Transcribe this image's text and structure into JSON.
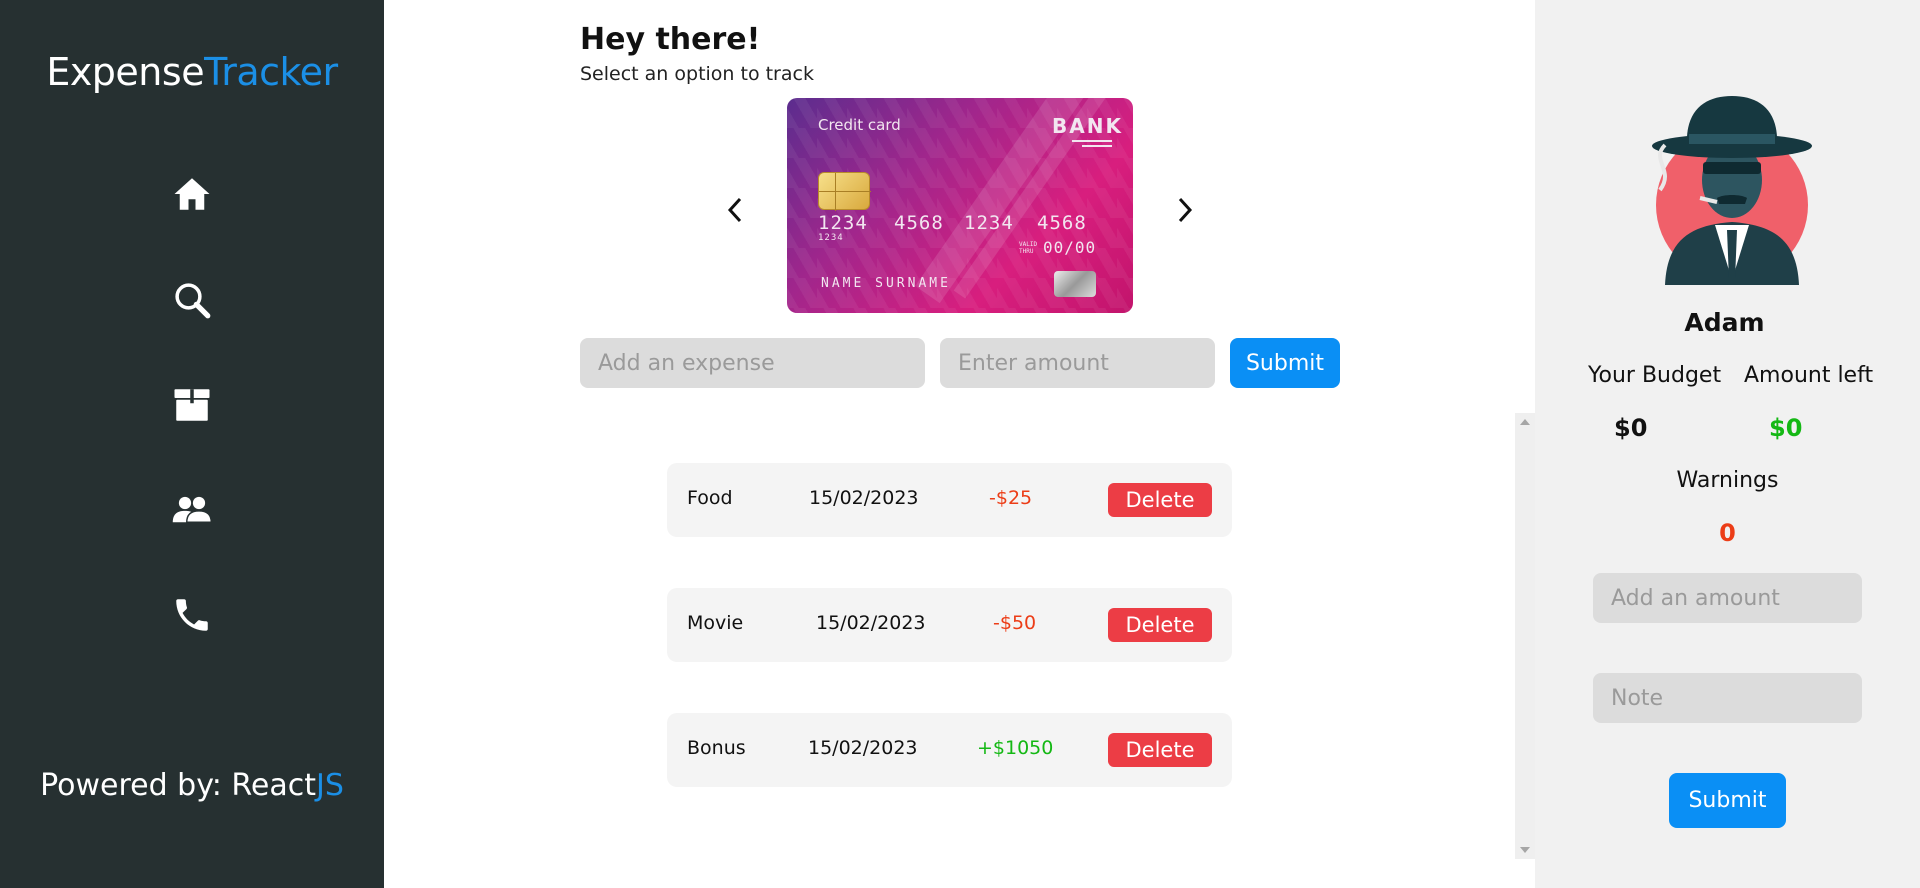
{
  "app": {
    "logo_part1": "Expense",
    "logo_part2": "Tracker",
    "powered_prefix": "Powered by: React",
    "powered_suffix": "JS",
    "accent_color": "#1b8fe6"
  },
  "sidebar": {
    "items": [
      {
        "icon": "home-icon"
      },
      {
        "icon": "search-icon"
      },
      {
        "icon": "archive-icon"
      },
      {
        "icon": "users-icon"
      },
      {
        "icon": "phone-icon"
      }
    ]
  },
  "main": {
    "greeting": "Hey there!",
    "subtitle": "Select an option to track",
    "card": {
      "type_label": "Credit card",
      "bank": "BANK",
      "number_part1": "1234",
      "number_part2": "4568",
      "number_part3": "1234",
      "number_part4": "4568",
      "small_number": "1234",
      "valid_thru_label": "VALID THRU",
      "expiry": "00/00",
      "holder": "NAME SURNAME"
    },
    "expense_placeholder": "Add an expense",
    "amount_placeholder": "Enter amount",
    "submit_label": "Submit",
    "transactions": [
      {
        "name": "Food",
        "date": "15/02/2023",
        "amount": "-$25",
        "type": "expense",
        "delete_label": "Delete"
      },
      {
        "name": "Movie",
        "date": "15/02/2023",
        "amount": "-$50",
        "type": "expense",
        "delete_label": "Delete"
      },
      {
        "name": "Bonus",
        "date": "15/02/2023",
        "amount": "+$1050",
        "type": "income",
        "delete_label": "Delete"
      }
    ]
  },
  "profile": {
    "name": "Adam",
    "budget_label": "Your Budget",
    "budget_value": "$0",
    "left_label": "Amount left",
    "left_value": "$0",
    "warnings_label": "Warnings",
    "warnings_value": "0",
    "amount_placeholder": "Add an amount",
    "note_placeholder": "Note",
    "submit_label": "Submit"
  },
  "colors": {
    "sidebar_bg": "#263031",
    "primary_button": "#0a8ff5",
    "delete_button": "#ec3d45",
    "negative": "#ec3d17",
    "positive": "#14b814"
  }
}
